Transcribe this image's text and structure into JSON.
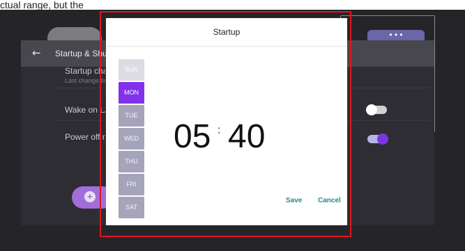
{
  "top_fragment": "ctual range, but the",
  "settings": {
    "back_icon": "arrow-left-icon",
    "title": "Startup & Shutdown",
    "rows": [
      {
        "title": "Startup change",
        "subtitle": "Last change time"
      },
      {
        "title": "Wake on LAN"
      },
      {
        "title": "Power off reminder"
      }
    ],
    "toggles": {
      "wake_on_lan": "off",
      "power_off_reminder": "on"
    },
    "add_button_icon": "plus-circle-icon"
  },
  "dialog": {
    "title": "Startup",
    "days": [
      {
        "label": "SUN",
        "state": "disabled"
      },
      {
        "label": "MON",
        "state": "selected"
      },
      {
        "label": "TUE",
        "state": "normal"
      },
      {
        "label": "WED",
        "state": "normal"
      },
      {
        "label": "THU",
        "state": "normal"
      },
      {
        "label": "FRI",
        "state": "normal"
      },
      {
        "label": "SAT",
        "state": "normal"
      }
    ],
    "time": {
      "hours": "05",
      "separator": ":",
      "minutes": "40"
    },
    "save_label": "Save",
    "cancel_label": "Cancel"
  },
  "colors": {
    "accent_purple": "#8232EA",
    "action_teal": "#2A8A82",
    "highlight_red": "#E0161A"
  }
}
